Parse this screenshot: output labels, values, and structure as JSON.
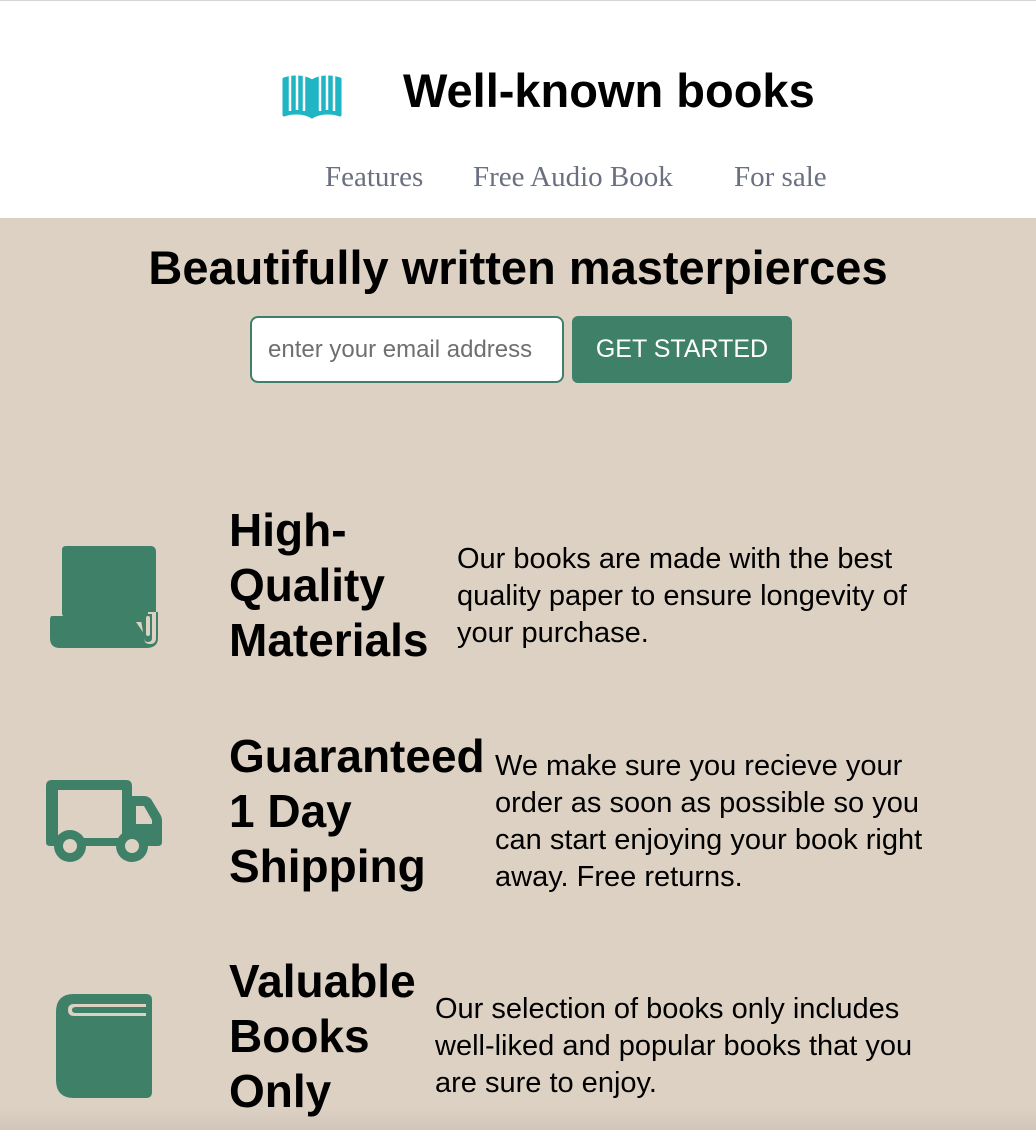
{
  "header": {
    "logo_icon": "open-book-icon",
    "title": "Well-known books",
    "nav": [
      {
        "label": "Features"
      },
      {
        "label": "Free Audio Book"
      },
      {
        "label": "For sale"
      }
    ]
  },
  "hero": {
    "title": "Beautifully written masterpierces",
    "email_placeholder": "enter your email address",
    "cta_label": "GET STARTED"
  },
  "features": [
    {
      "icon": "book-scroll-icon",
      "title_lines": [
        "High-",
        "Quality",
        "Materials"
      ],
      "description_lines": [
        "Our books are made with the best",
        "quality paper to ensure longevity of",
        "your purchase."
      ]
    },
    {
      "icon": "truck-icon",
      "title_lines": [
        "Guaranteed",
        "1 Day",
        "Shipping"
      ],
      "description_lines": [
        "We make sure you recieve your",
        "order as soon as possible so you",
        "can start enjoying your book right",
        "away. Free returns."
      ]
    },
    {
      "icon": "book-icon",
      "title_lines": [
        "Valuable",
        "Books",
        "Only"
      ],
      "description_lines": [
        "Our selection of books only includes",
        "well-liked and popular books that you",
        "are sure to enjoy."
      ]
    }
  ],
  "colors": {
    "accent": "#3e8168",
    "logo": "#1fb5c4",
    "background": "#ddd1c4",
    "nav_text": "#6b7080"
  }
}
